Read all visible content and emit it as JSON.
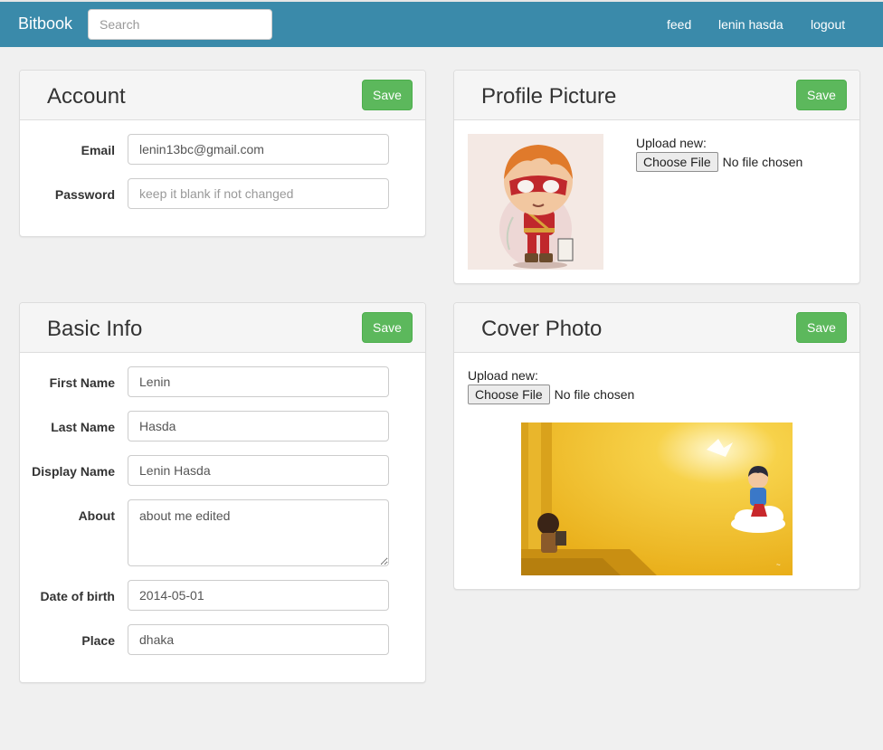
{
  "app": {
    "brand": "Bitbook"
  },
  "header": {
    "search_placeholder": "Search",
    "nav": {
      "feed": "feed",
      "user": "lenin hasda",
      "logout": "logout"
    }
  },
  "account": {
    "title": "Account",
    "save_label": "Save",
    "email_label": "Email",
    "email_value": "lenin13bc@gmail.com",
    "password_label": "Password",
    "password_placeholder": "keep it blank if not changed"
  },
  "profile_picture": {
    "title": "Profile Picture",
    "save_label": "Save",
    "upload_label": "Upload new:",
    "choose_label": "Choose File",
    "file_status": "No file chosen"
  },
  "basic_info": {
    "title": "Basic Info",
    "save_label": "Save",
    "first_name_label": "First Name",
    "first_name_value": "Lenin",
    "last_name_label": "Last Name",
    "last_name_value": "Hasda",
    "display_name_label": "Display Name",
    "display_name_value": "Lenin Hasda",
    "about_label": "About",
    "about_value": "about me edited",
    "dob_label": "Date of birth",
    "dob_value": "2014-05-01",
    "place_label": "Place",
    "place_value": "dhaka"
  },
  "cover_photo": {
    "title": "Cover Photo",
    "save_label": "Save",
    "upload_label": "Upload new:",
    "choose_label": "Choose File",
    "file_status": "No file chosen"
  },
  "colors": {
    "navbar": "#3a8aaa",
    "save_button": "#5cb85c",
    "page_background": "#f0f0f0"
  }
}
